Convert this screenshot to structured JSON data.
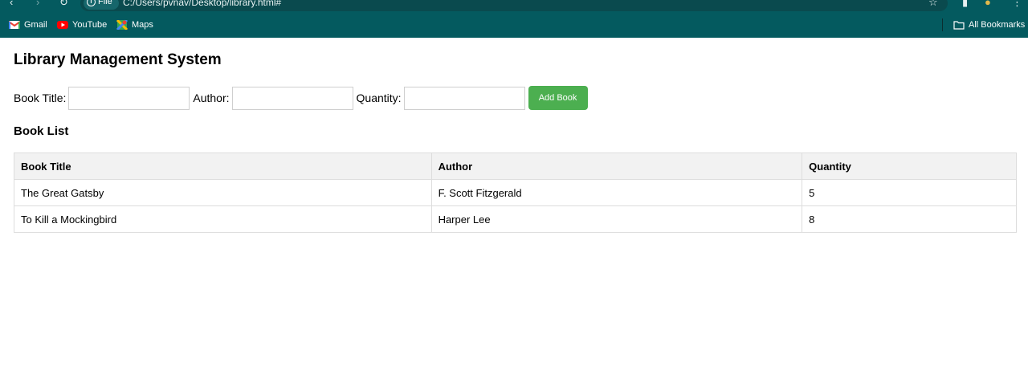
{
  "browser": {
    "url_chip": "File",
    "url": "C:/Users/pvnav/Desktop/library.html#",
    "bookmarks": [
      {
        "label": "Gmail",
        "icon": "gmail-icon"
      },
      {
        "label": "YouTube",
        "icon": "youtube-icon"
      },
      {
        "label": "Maps",
        "icon": "maps-icon"
      }
    ],
    "all_bookmarks": "All Bookmarks"
  },
  "page": {
    "title": "Library Management System",
    "form": {
      "title_label": "Book Title:",
      "author_label": "Author:",
      "quantity_label": "Quantity:",
      "title_value": "",
      "author_value": "",
      "quantity_value": "",
      "add_button": "Add Book"
    },
    "list_title": "Book List",
    "table": {
      "headers": [
        "Book Title",
        "Author",
        "Quantity"
      ],
      "rows": [
        [
          "The Great Gatsby",
          "F. Scott Fitzgerald",
          "5"
        ],
        [
          "To Kill a Mockingbird",
          "Harper Lee",
          "8"
        ]
      ]
    }
  },
  "colors": {
    "chrome": "#045a5f",
    "button": "#4caf50",
    "header_bg": "#f2f2f2"
  }
}
